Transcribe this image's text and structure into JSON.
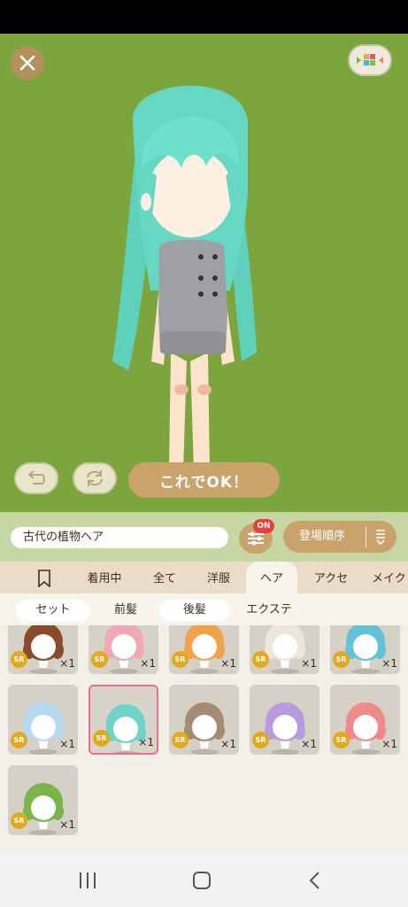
{
  "top": {
    "close_icon": "close-icon",
    "view_icon": "palette-view-icon",
    "undo_icon": "undo-icon",
    "reset_icon": "refresh-icon",
    "ok_label": "これでOK！"
  },
  "colors": {
    "stage_bg": "#7ca53e",
    "accent_button": "#c9a36b",
    "badge_red": "#e8403c",
    "rarity_gold": "#e3a91d",
    "selected_border": "#e96e88"
  },
  "namebar": {
    "item_name": "古代の植物ヘア",
    "filter_icon": "sliders-icon",
    "filter_badge": "ON",
    "sort_label": "登場順序",
    "sort_icon": "sort-order-icon"
  },
  "tabs": {
    "bookmark_icon": "bookmark-icon",
    "items": [
      {
        "label": "着用中"
      },
      {
        "label": "全て"
      },
      {
        "label": "洋服"
      },
      {
        "label": "ヘア"
      },
      {
        "label": "アクセ"
      },
      {
        "label": "メイク"
      }
    ],
    "active": "ヘア"
  },
  "subtabs": {
    "items": [
      {
        "label": "セット"
      },
      {
        "label": "前髪"
      },
      {
        "label": "後髪"
      },
      {
        "label": "エクステ"
      }
    ]
  },
  "grid": {
    "items": [
      {
        "rarity": "SR",
        "count": "×1",
        "hair_color": "#8a4b2c"
      },
      {
        "rarity": "SR",
        "count": "×1",
        "hair_color": "#f0a9b4"
      },
      {
        "rarity": "SR",
        "count": "×1",
        "hair_color": "#f0a34c"
      },
      {
        "rarity": "SR",
        "count": "×1",
        "hair_color": "#ece6dc"
      },
      {
        "rarity": "SR",
        "count": "×1",
        "hair_color": "#62c3d8"
      },
      {
        "rarity": "SR",
        "count": "×1",
        "hair_color": "#b6d9f2"
      },
      {
        "rarity": "SR",
        "count": "×1",
        "hair_color": "#6fd4c7"
      },
      {
        "rarity": "SR",
        "count": "×1",
        "hair_color": "#a48b72"
      },
      {
        "rarity": "SR",
        "count": "×1",
        "hair_color": "#b79ae0"
      },
      {
        "rarity": "SR",
        "count": "×1",
        "hair_color": "#f08a8a"
      },
      {
        "rarity": "SR",
        "count": "×1",
        "hair_color": "#7ab549"
      }
    ],
    "selected_index": 6
  },
  "system_nav": {
    "recents_icon": "recents-icon",
    "home_icon": "home-icon",
    "back_icon": "back-icon"
  }
}
